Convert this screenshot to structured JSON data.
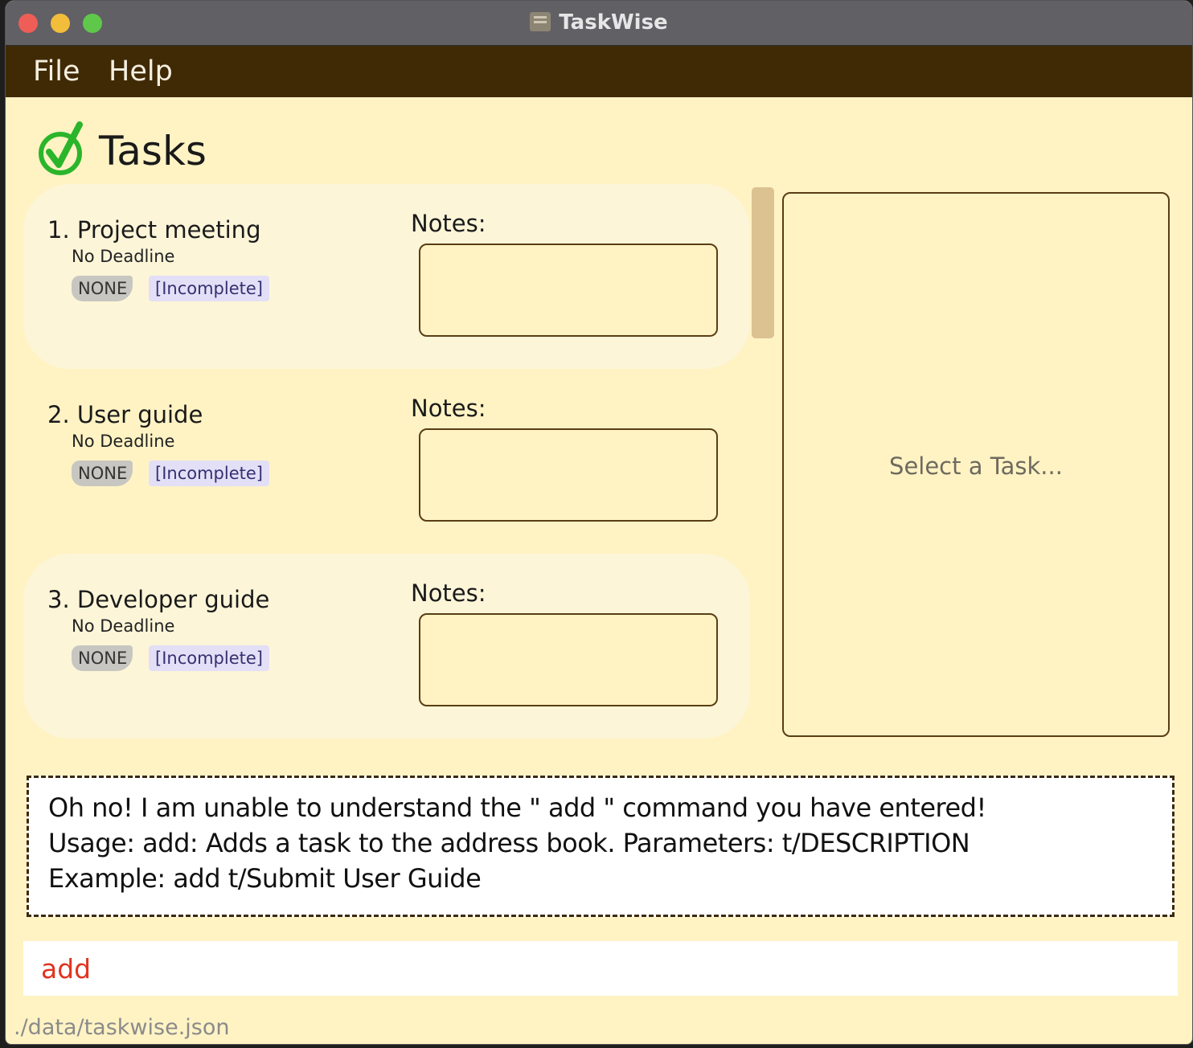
{
  "window": {
    "title": "TaskWise",
    "app_icon": "taskwise-app-icon"
  },
  "menu": {
    "file_label": "File",
    "help_label": "Help"
  },
  "tasks_panel": {
    "title": "Tasks",
    "icon": "green-check-icon",
    "tasks": [
      {
        "name": "1. Project meeting",
        "deadline": "No Deadline",
        "priority": "NONE",
        "status": "[Incomplete]",
        "notes_label": "Notes:"
      },
      {
        "name": "2. User guide",
        "deadline": "No Deadline",
        "priority": "NONE",
        "status": "[Incomplete]",
        "notes_label": "Notes:"
      },
      {
        "name": "3. Developer guide",
        "deadline": "No Deadline",
        "priority": "NONE",
        "status": "[Incomplete]",
        "notes_label": "Notes:"
      }
    ]
  },
  "detail_panel": {
    "placeholder": "Select a Task..."
  },
  "result_display": {
    "lines": [
      "Oh no! I am unable to understand the  \" add \" command you have entered!",
      "Usage: add: Adds a task to the address book. Parameters: t/DESCRIPTION",
      "Example: add t/Submit User Guide"
    ]
  },
  "command_box": {
    "value": "add"
  },
  "status_bar": {
    "path": "./data/taskwise.json"
  },
  "colors": {
    "background": "#fff3c4",
    "menubar": "#402a05",
    "card": "#fcf5d8",
    "border": "#5a3d14",
    "command_error_text": "#e0341f",
    "check_green": "#2bb52b"
  }
}
